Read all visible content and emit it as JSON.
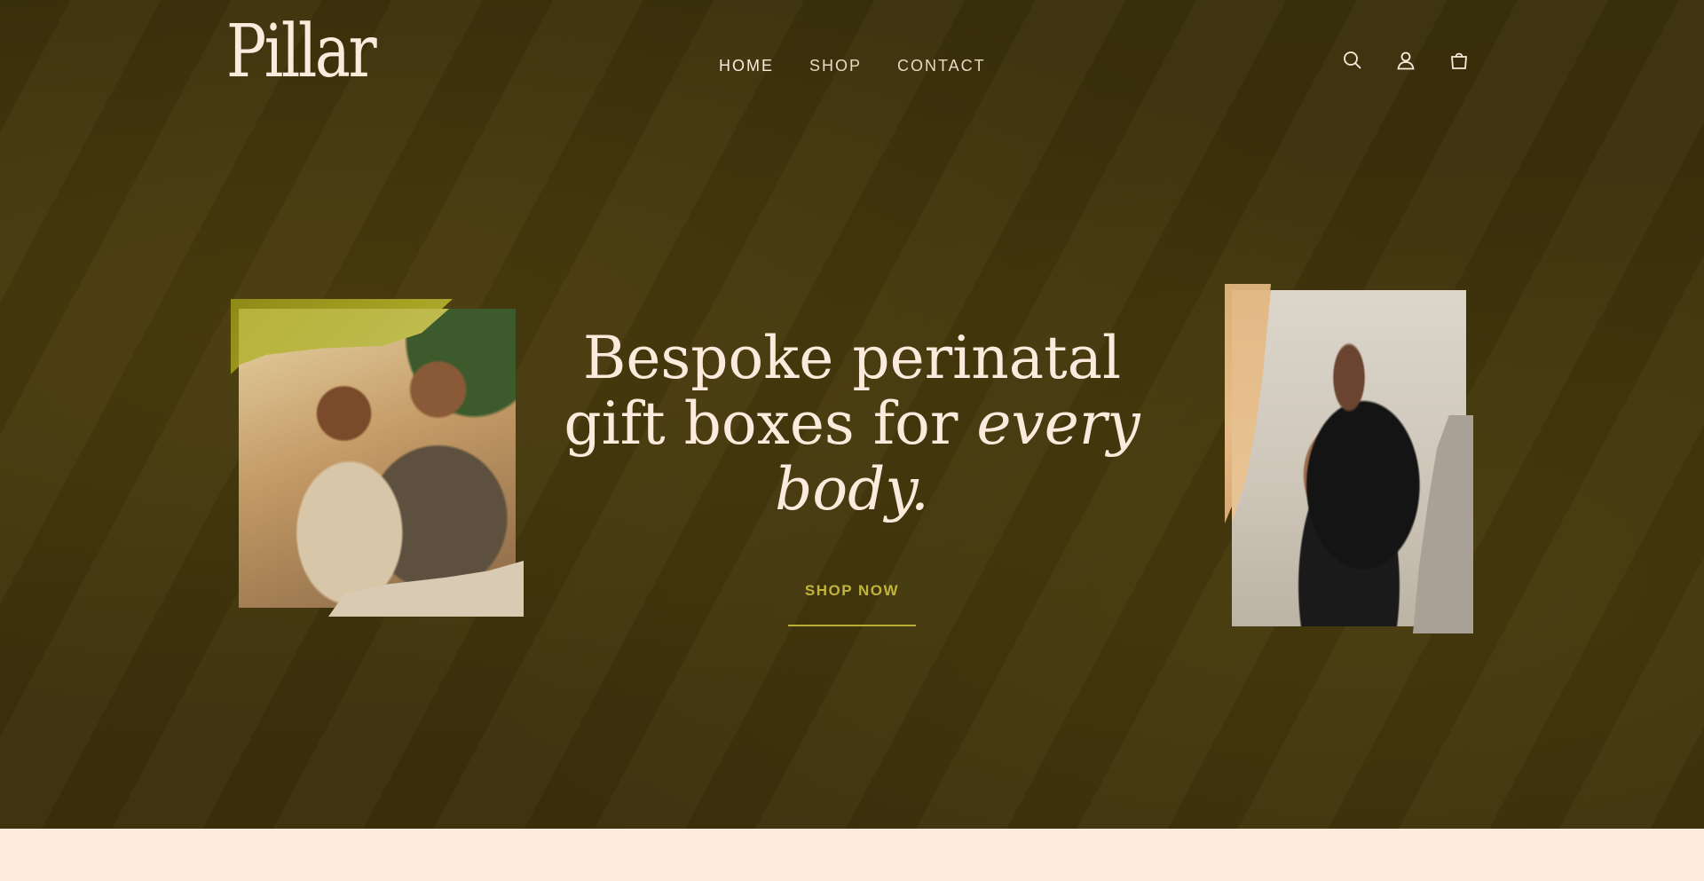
{
  "brand": {
    "logo_text": "Pillar"
  },
  "nav": {
    "items": [
      {
        "label": "HOME",
        "active": true
      },
      {
        "label": "SHOP",
        "active": false
      },
      {
        "label": "CONTACT",
        "active": false
      }
    ]
  },
  "header_icons": [
    "search-icon",
    "account-icon",
    "cart-icon"
  ],
  "hero": {
    "headline_line1": "Bespoke perinatal",
    "headline_line2_plain": "gift boxes for ",
    "headline_line2_italic": "every",
    "headline_line3_italic": "body.",
    "cta_label": "SHOP NOW"
  },
  "colors": {
    "hero_bg": "#3e330b",
    "text_light": "#fcebdc",
    "accent": "#b9ad33",
    "footer_band": "#fcebdc"
  }
}
